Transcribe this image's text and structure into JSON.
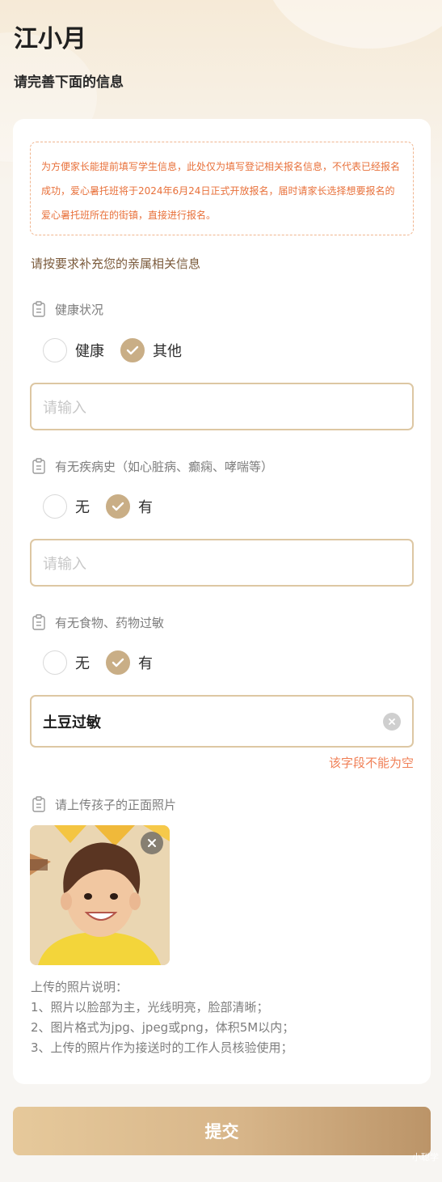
{
  "page": {
    "title": "江小月",
    "subtitle": "请完善下面的信息"
  },
  "notice": {
    "text": "为方便家长能提前填写学生信息，此处仅为填写登记相关报名信息，不代表已经报名成功，爱心暑托班将于2024年6月24日正式开放报名，届时请家长选择想要报名的爱心暑托班所在的街镇，直接进行报名。"
  },
  "section_tip": "请按要求补充您的亲属相关信息",
  "fields": {
    "health": {
      "label": "健康状况",
      "options": [
        "健康",
        "其他"
      ],
      "selected": "其他",
      "placeholder": "请输入",
      "value": ""
    },
    "disease": {
      "label": "有无疾病史（如心脏病、癫痫、哮喘等）",
      "options": [
        "无",
        "有"
      ],
      "selected": "有",
      "placeholder": "请输入",
      "value": ""
    },
    "allergy": {
      "label": "有无食物、药物过敏",
      "options": [
        "无",
        "有"
      ],
      "selected": "有",
      "value": "土豆过敏",
      "error": "该字段不能为空"
    },
    "photo": {
      "label": "请上传孩子的正面照片"
    }
  },
  "upload_notes": {
    "title": "上传的照片说明：",
    "items": [
      "1、照片以脸部为主，光线明亮，脸部清晰；",
      "2、图片格式为jpg、jpeg或png，体积5M以内；",
      "3、上传的照片作为接送时的工作人员核验使用；"
    ]
  },
  "submit_label": "提交",
  "watermark": "小聪学",
  "colors": {
    "accent": "#c9ae86",
    "input_border": "#ddc7a3",
    "notice_text": "#e8703a",
    "error": "#f08057"
  },
  "icons": {
    "field": "clipboard-icon",
    "check": "check-icon",
    "clear": "clear-icon",
    "close": "close-icon"
  }
}
